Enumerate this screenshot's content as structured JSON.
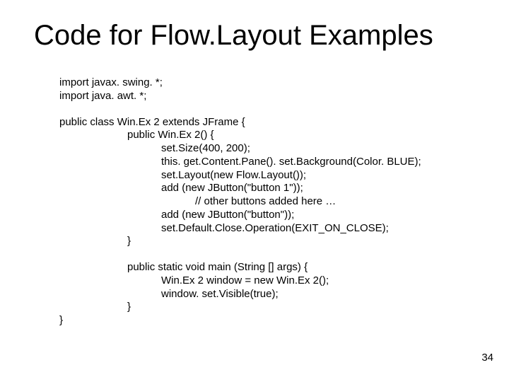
{
  "title": "Code for Flow.Layout Examples",
  "code": {
    "l01": "import javax. swing. *;",
    "l02": "import java. awt. *;",
    "l03": "public class Win.Ex 2 extends JFrame {",
    "l04": "public Win.Ex 2() {",
    "l05": "set.Size(400, 200);",
    "l06": "this. get.Content.Pane(). set.Background(Color. BLUE);",
    "l07": "set.Layout(new Flow.Layout());",
    "l08": "add (new JButton(\"button 1\"));",
    "l09": "// other buttons added here …",
    "l10": "add (new JButton(\"button\"));",
    "l11": "set.Default.Close.Operation(EXIT_ON_CLOSE);",
    "l12": "}",
    "l13": "public static void main (String [] args) {",
    "l14": "Win.Ex 2 window = new Win.Ex 2();",
    "l15": "window. set.Visible(true);",
    "l16": "}",
    "l17": "}"
  },
  "pagenum": "34"
}
